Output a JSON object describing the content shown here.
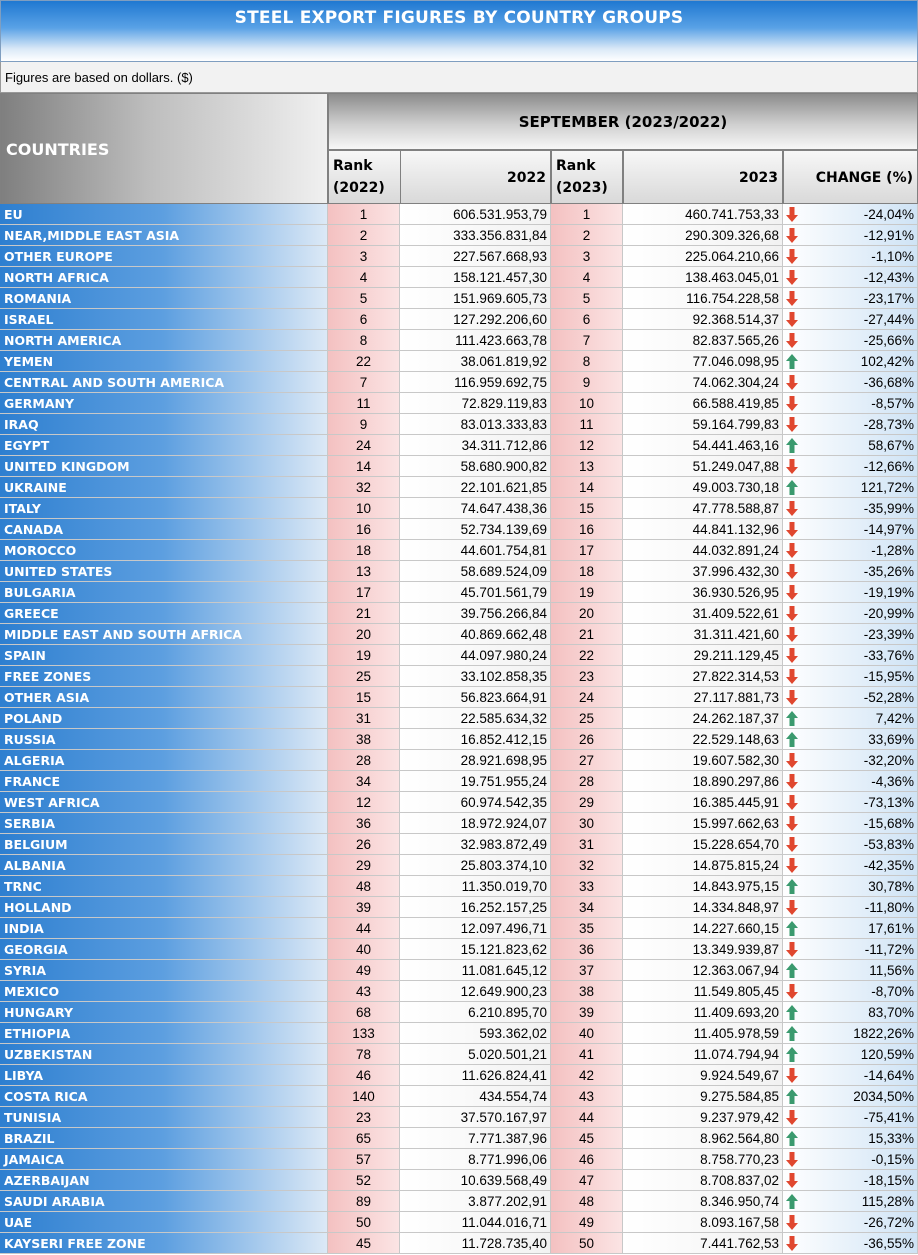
{
  "title": "STEEL EXPORT FIGURES BY COUNTRY GROUPS",
  "note": "Figures are based on dollars. ($)",
  "headers": {
    "countries": "COUNTRIES",
    "period": "SEPTEMBER (2023/2022)",
    "rank2022": "Rank\n(2022)",
    "v2022": "2022",
    "rank2023": "Rank\n(2023)",
    "v2023": "2023",
    "change": "CHANGE (%)"
  },
  "colors": {
    "up": "#3a9a6e",
    "down": "#e0472f"
  },
  "rows": [
    {
      "country": "EU",
      "r22": "1",
      "v22": "606.531.953,79",
      "r23": "1",
      "v23": "460.741.753,33",
      "dir": "down",
      "chg": "-24,04%"
    },
    {
      "country": "NEAR,MIDDLE EAST ASIA",
      "r22": "2",
      "v22": "333.356.831,84",
      "r23": "2",
      "v23": "290.309.326,68",
      "dir": "down",
      "chg": "-12,91%"
    },
    {
      "country": "OTHER EUROPE",
      "r22": "3",
      "v22": "227.567.668,93",
      "r23": "3",
      "v23": "225.064.210,66",
      "dir": "down",
      "chg": "-1,10%"
    },
    {
      "country": "NORTH AFRICA",
      "r22": "4",
      "v22": "158.121.457,30",
      "r23": "4",
      "v23": "138.463.045,01",
      "dir": "down",
      "chg": "-12,43%"
    },
    {
      "country": "ROMANIA",
      "r22": "5",
      "v22": "151.969.605,73",
      "r23": "5",
      "v23": "116.754.228,58",
      "dir": "down",
      "chg": "-23,17%"
    },
    {
      "country": "ISRAEL",
      "r22": "6",
      "v22": "127.292.206,60",
      "r23": "6",
      "v23": "92.368.514,37",
      "dir": "down",
      "chg": "-27,44%"
    },
    {
      "country": "NORTH AMERICA",
      "r22": "8",
      "v22": "111.423.663,78",
      "r23": "7",
      "v23": "82.837.565,26",
      "dir": "down",
      "chg": "-25,66%"
    },
    {
      "country": "YEMEN",
      "r22": "22",
      "v22": "38.061.819,92",
      "r23": "8",
      "v23": "77.046.098,95",
      "dir": "up",
      "chg": "102,42%"
    },
    {
      "country": "CENTRAL AND SOUTH AMERICA",
      "r22": "7",
      "v22": "116.959.692,75",
      "r23": "9",
      "v23": "74.062.304,24",
      "dir": "down",
      "chg": "-36,68%"
    },
    {
      "country": "GERMANY",
      "r22": "11",
      "v22": "72.829.119,83",
      "r23": "10",
      "v23": "66.588.419,85",
      "dir": "down",
      "chg": "-8,57%"
    },
    {
      "country": "IRAQ",
      "r22": "9",
      "v22": "83.013.333,83",
      "r23": "11",
      "v23": "59.164.799,83",
      "dir": "down",
      "chg": "-28,73%"
    },
    {
      "country": "EGYPT",
      "r22": "24",
      "v22": "34.311.712,86",
      "r23": "12",
      "v23": "54.441.463,16",
      "dir": "up",
      "chg": "58,67%"
    },
    {
      "country": "UNITED KINGDOM",
      "r22": "14",
      "v22": "58.680.900,82",
      "r23": "13",
      "v23": "51.249.047,88",
      "dir": "down",
      "chg": "-12,66%"
    },
    {
      "country": "UKRAINE",
      "r22": "32",
      "v22": "22.101.621,85",
      "r23": "14",
      "v23": "49.003.730,18",
      "dir": "up",
      "chg": "121,72%"
    },
    {
      "country": "ITALY",
      "r22": "10",
      "v22": "74.647.438,36",
      "r23": "15",
      "v23": "47.778.588,87",
      "dir": "down",
      "chg": "-35,99%"
    },
    {
      "country": "CANADA",
      "r22": "16",
      "v22": "52.734.139,69",
      "r23": "16",
      "v23": "44.841.132,96",
      "dir": "down",
      "chg": "-14,97%"
    },
    {
      "country": "MOROCCO",
      "r22": "18",
      "v22": "44.601.754,81",
      "r23": "17",
      "v23": "44.032.891,24",
      "dir": "down",
      "chg": "-1,28%"
    },
    {
      "country": "UNITED STATES",
      "r22": "13",
      "v22": "58.689.524,09",
      "r23": "18",
      "v23": "37.996.432,30",
      "dir": "down",
      "chg": "-35,26%"
    },
    {
      "country": "BULGARIA",
      "r22": "17",
      "v22": "45.701.561,79",
      "r23": "19",
      "v23": "36.930.526,95",
      "dir": "down",
      "chg": "-19,19%"
    },
    {
      "country": "GREECE",
      "r22": "21",
      "v22": "39.756.266,84",
      "r23": "20",
      "v23": "31.409.522,61",
      "dir": "down",
      "chg": "-20,99%"
    },
    {
      "country": "MIDDLE EAST AND SOUTH AFRICA",
      "r22": "20",
      "v22": "40.869.662,48",
      "r23": "21",
      "v23": "31.311.421,60",
      "dir": "down",
      "chg": "-23,39%"
    },
    {
      "country": "SPAIN",
      "r22": "19",
      "v22": "44.097.980,24",
      "r23": "22",
      "v23": "29.211.129,45",
      "dir": "down",
      "chg": "-33,76%"
    },
    {
      "country": "FREE ZONES",
      "r22": "25",
      "v22": "33.102.858,35",
      "r23": "23",
      "v23": "27.822.314,53",
      "dir": "down",
      "chg": "-15,95%"
    },
    {
      "country": "OTHER ASIA",
      "r22": "15",
      "v22": "56.823.664,91",
      "r23": "24",
      "v23": "27.117.881,73",
      "dir": "down",
      "chg": "-52,28%"
    },
    {
      "country": "POLAND",
      "r22": "31",
      "v22": "22.585.634,32",
      "r23": "25",
      "v23": "24.262.187,37",
      "dir": "up",
      "chg": "7,42%"
    },
    {
      "country": "RUSSIA",
      "r22": "38",
      "v22": "16.852.412,15",
      "r23": "26",
      "v23": "22.529.148,63",
      "dir": "up",
      "chg": "33,69%"
    },
    {
      "country": "ALGERIA",
      "r22": "28",
      "v22": "28.921.698,95",
      "r23": "27",
      "v23": "19.607.582,30",
      "dir": "down",
      "chg": "-32,20%"
    },
    {
      "country": "FRANCE",
      "r22": "34",
      "v22": "19.751.955,24",
      "r23": "28",
      "v23": "18.890.297,86",
      "dir": "down",
      "chg": "-4,36%"
    },
    {
      "country": "WEST AFRICA",
      "r22": "12",
      "v22": "60.974.542,35",
      "r23": "29",
      "v23": "16.385.445,91",
      "dir": "down",
      "chg": "-73,13%"
    },
    {
      "country": "SERBIA",
      "r22": "36",
      "v22": "18.972.924,07",
      "r23": "30",
      "v23": "15.997.662,63",
      "dir": "down",
      "chg": "-15,68%"
    },
    {
      "country": "BELGIUM",
      "r22": "26",
      "v22": "32.983.872,49",
      "r23": "31",
      "v23": "15.228.654,70",
      "dir": "down",
      "chg": "-53,83%"
    },
    {
      "country": "ALBANIA",
      "r22": "29",
      "v22": "25.803.374,10",
      "r23": "32",
      "v23": "14.875.815,24",
      "dir": "down",
      "chg": "-42,35%"
    },
    {
      "country": "TRNC",
      "r22": "48",
      "v22": "11.350.019,70",
      "r23": "33",
      "v23": "14.843.975,15",
      "dir": "up",
      "chg": "30,78%"
    },
    {
      "country": "HOLLAND",
      "r22": "39",
      "v22": "16.252.157,25",
      "r23": "34",
      "v23": "14.334.848,97",
      "dir": "down",
      "chg": "-11,80%"
    },
    {
      "country": "INDIA",
      "r22": "44",
      "v22": "12.097.496,71",
      "r23": "35",
      "v23": "14.227.660,15",
      "dir": "up",
      "chg": "17,61%"
    },
    {
      "country": "GEORGIA",
      "r22": "40",
      "v22": "15.121.823,62",
      "r23": "36",
      "v23": "13.349.939,87",
      "dir": "down",
      "chg": "-11,72%"
    },
    {
      "country": "SYRIA",
      "r22": "49",
      "v22": "11.081.645,12",
      "r23": "37",
      "v23": "12.363.067,94",
      "dir": "up",
      "chg": "11,56%"
    },
    {
      "country": "MEXICO",
      "r22": "43",
      "v22": "12.649.900,23",
      "r23": "38",
      "v23": "11.549.805,45",
      "dir": "down",
      "chg": "-8,70%"
    },
    {
      "country": "HUNGARY",
      "r22": "68",
      "v22": "6.210.895,70",
      "r23": "39",
      "v23": "11.409.693,20",
      "dir": "up",
      "chg": "83,70%"
    },
    {
      "country": "ETHIOPIA",
      "r22": "133",
      "v22": "593.362,02",
      "r23": "40",
      "v23": "11.405.978,59",
      "dir": "up",
      "chg": "1822,26%"
    },
    {
      "country": "UZBEKISTAN",
      "r22": "78",
      "v22": "5.020.501,21",
      "r23": "41",
      "v23": "11.074.794,94",
      "dir": "up",
      "chg": "120,59%"
    },
    {
      "country": "LIBYA",
      "r22": "46",
      "v22": "11.626.824,41",
      "r23": "42",
      "v23": "9.924.549,67",
      "dir": "down",
      "chg": "-14,64%"
    },
    {
      "country": "COSTA RICA",
      "r22": "140",
      "v22": "434.554,74",
      "r23": "43",
      "v23": "9.275.584,85",
      "dir": "up",
      "chg": "2034,50%"
    },
    {
      "country": "TUNISIA",
      "r22": "23",
      "v22": "37.570.167,97",
      "r23": "44",
      "v23": "9.237.979,42",
      "dir": "down",
      "chg": "-75,41%"
    },
    {
      "country": "BRAZIL",
      "r22": "65",
      "v22": "7.771.387,96",
      "r23": "45",
      "v23": "8.962.564,80",
      "dir": "up",
      "chg": "15,33%"
    },
    {
      "country": "JAMAICA",
      "r22": "57",
      "v22": "8.771.996,06",
      "r23": "46",
      "v23": "8.758.770,23",
      "dir": "down",
      "chg": "-0,15%"
    },
    {
      "country": "AZERBAIJAN",
      "r22": "52",
      "v22": "10.639.568,49",
      "r23": "47",
      "v23": "8.708.837,02",
      "dir": "down",
      "chg": "-18,15%"
    },
    {
      "country": "SAUDI ARABIA",
      "r22": "89",
      "v22": "3.877.202,91",
      "r23": "48",
      "v23": "8.346.950,74",
      "dir": "up",
      "chg": "115,28%"
    },
    {
      "country": "UAE",
      "r22": "50",
      "v22": "11.044.016,71",
      "r23": "49",
      "v23": "8.093.167,58",
      "dir": "down",
      "chg": "-26,72%"
    },
    {
      "country": "KAYSERI FREE ZONE",
      "r22": "45",
      "v22": "11.728.735,40",
      "r23": "50",
      "v23": "7.441.762,53",
      "dir": "down",
      "chg": "-36,55%"
    }
  ]
}
